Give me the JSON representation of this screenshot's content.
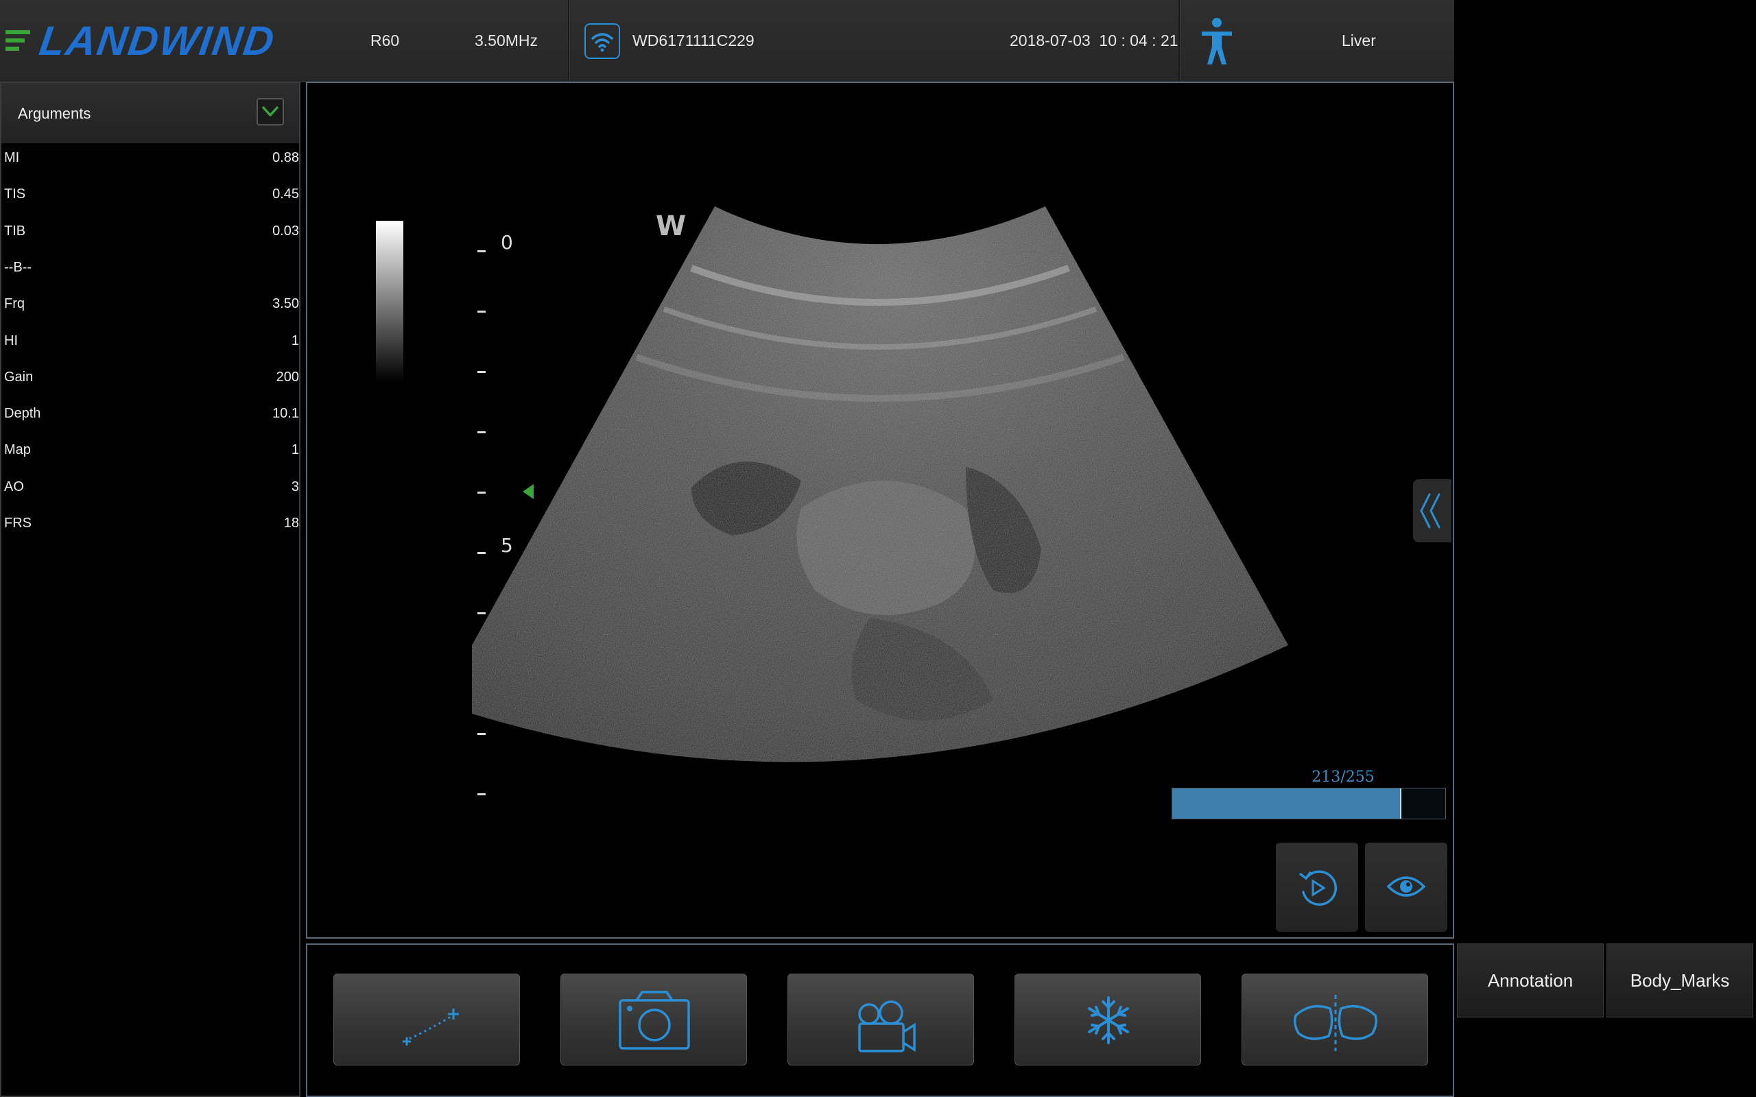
{
  "brand": {
    "logo_text": "LANDWIND",
    "logo_color": "#1f6fd0",
    "accent_green": "#3aa63a"
  },
  "header": {
    "probe": "R60",
    "frequency": "3.50MHz",
    "wifi_icon": "wifi-icon",
    "device_id": "WD6171111C229",
    "datetime": "2018-07-03  10 : 04 : 21",
    "body_icon": "human-figure-icon",
    "preset": "Liver"
  },
  "arguments": {
    "title": "Arguments",
    "toggle_icon": "chevron-down-icon",
    "rows": [
      {
        "label": "MI",
        "value": "0.88"
      },
      {
        "label": "TIS",
        "value": "0.45"
      },
      {
        "label": "TIB",
        "value": "0.03"
      },
      {
        "label": "--B--",
        "value": ""
      },
      {
        "label": "Frq",
        "value": "3.50"
      },
      {
        "label": "HI",
        "value": "1"
      },
      {
        "label": "Gain",
        "value": "200"
      },
      {
        "label": "Depth",
        "value": "10.1"
      },
      {
        "label": "Map",
        "value": "1"
      },
      {
        "label": "AO",
        "value": "3"
      },
      {
        "label": "FRS",
        "value": "18"
      }
    ]
  },
  "image": {
    "depth_labels": [
      "0",
      "5"
    ],
    "cine_counter": "213/255",
    "cine_current": 213,
    "cine_total": 255,
    "replay_icon": "replay-icon",
    "view_icon": "eye-icon",
    "collapse_icon": "double-chevron-left-icon"
  },
  "toolbar": {
    "buttons": [
      {
        "icon": "measure-icon"
      },
      {
        "icon": "camera-icon"
      },
      {
        "icon": "video-camera-icon"
      },
      {
        "icon": "freeze-snowflake-icon"
      },
      {
        "icon": "dual-view-icon"
      }
    ],
    "icon_color": "#2b8fd6"
  },
  "right_buttons": {
    "annotation": "Annotation",
    "body_marks": "Body_Marks"
  }
}
